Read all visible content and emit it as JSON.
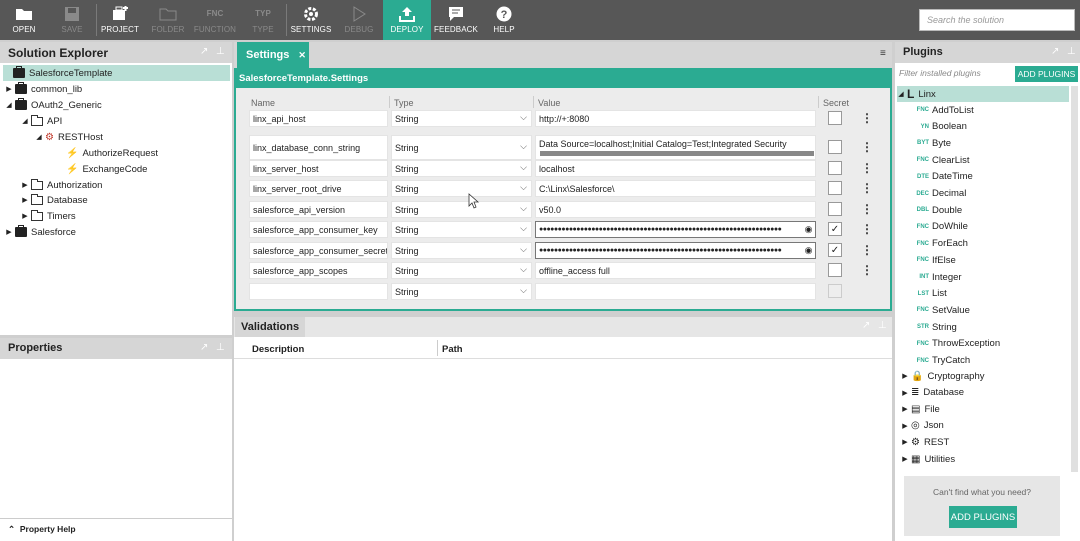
{
  "toolbar": {
    "open": "OPEN",
    "save": "SAVE",
    "project": "PROJECT",
    "folder": "FOLDER",
    "function": "FUNCTION",
    "type": "TYPE",
    "settings": "SETTINGS",
    "debug": "DEBUG",
    "deploy": "DEPLOY",
    "feedback": "FEEDBACK",
    "help": "HELP",
    "fnc_glyph": "FNC",
    "typ_glyph": "TYP",
    "search_placeholder": "Search the solution"
  },
  "solution_explorer": {
    "title": "Solution Explorer",
    "items": [
      {
        "label": "SalesforceTemplate"
      },
      {
        "label": "common_lib"
      },
      {
        "label": "OAuth2_Generic"
      },
      {
        "label": "API"
      },
      {
        "label": "RESTHost"
      },
      {
        "label": "AuthorizeRequest"
      },
      {
        "label": "ExchangeCode"
      },
      {
        "label": "Authorization"
      },
      {
        "label": "Database"
      },
      {
        "label": "Timers"
      },
      {
        "label": "Salesforce"
      }
    ]
  },
  "properties": {
    "title": "Properties",
    "help": "Property Help"
  },
  "settings": {
    "tab_label": "Settings",
    "header": "SalesforceTemplate.Settings",
    "columns": {
      "name": "Name",
      "type": "Type",
      "value": "Value",
      "secret": "Secret"
    },
    "rows": [
      {
        "name": "linx_api_host",
        "type": "String",
        "value": "http://+:8080",
        "secret": false
      },
      {
        "name": "linx_database_conn_string",
        "type": "String",
        "value": "Data Source=localhost;Initial Catalog=Test;Integrated Security",
        "secret": false
      },
      {
        "name": "linx_server_host",
        "type": "String",
        "value": "localhost",
        "secret": false
      },
      {
        "name": "linx_server_root_drive",
        "type": "String",
        "value": "C:\\Linx\\Salesforce\\",
        "secret": false
      },
      {
        "name": "salesforce_api_version",
        "type": "String",
        "value": "v50.0",
        "secret": false
      },
      {
        "name": "salesforce_app_consumer_key",
        "type": "String",
        "value": "●●●●●●●●●●●●●●●●●●●●●●●●●●●●●●●●●●●●●●●●●●●●●●●●●●●●●●●●●●●●●●●●●",
        "secret": true
      },
      {
        "name": "salesforce_app_consumer_secret",
        "type": "String",
        "value": "●●●●●●●●●●●●●●●●●●●●●●●●●●●●●●●●●●●●●●●●●●●●●●●●●●●●●●●●●●●●●●●●●",
        "secret": true
      },
      {
        "name": "salesforce_app_scopes",
        "type": "String",
        "value": "offline_access full",
        "secret": false
      },
      {
        "name": "",
        "type": "String",
        "value": "",
        "secret": false
      }
    ]
  },
  "validations": {
    "title": "Validations",
    "columns": {
      "description": "Description",
      "path": "Path"
    }
  },
  "plugins": {
    "title": "Plugins",
    "filter_placeholder": "Filter installed plugins",
    "add_button": "ADD PLUGINS",
    "linx_group": "Linx",
    "linx_items": [
      {
        "prefix": "FNC",
        "label": "AddToList"
      },
      {
        "prefix": "YN",
        "label": "Boolean"
      },
      {
        "prefix": "BYT",
        "label": "Byte"
      },
      {
        "prefix": "FNC",
        "label": "ClearList"
      },
      {
        "prefix": "DTE",
        "label": "DateTime"
      },
      {
        "prefix": "DEC",
        "label": "Decimal"
      },
      {
        "prefix": "DBL",
        "label": "Double"
      },
      {
        "prefix": "FNC",
        "label": "DoWhile"
      },
      {
        "prefix": "FNC",
        "label": "ForEach"
      },
      {
        "prefix": "FNC",
        "label": "IfElse"
      },
      {
        "prefix": "INT",
        "label": "Integer"
      },
      {
        "prefix": "LST",
        "label": "List"
      },
      {
        "prefix": "FNC",
        "label": "SetValue"
      },
      {
        "prefix": "STR",
        "label": "String"
      },
      {
        "prefix": "FNC",
        "label": "ThrowException"
      },
      {
        "prefix": "FNC",
        "label": "TryCatch"
      }
    ],
    "groups": [
      {
        "label": "Cryptography"
      },
      {
        "label": "Database"
      },
      {
        "label": "File"
      },
      {
        "label": "Json"
      },
      {
        "label": "REST"
      },
      {
        "label": "Utilities"
      }
    ],
    "cant_find": "Can't find what you need?",
    "add_button_bottom": "ADD PLUGINS"
  },
  "colors": {
    "accent": "#2bab92",
    "toolbar": "#575757"
  }
}
